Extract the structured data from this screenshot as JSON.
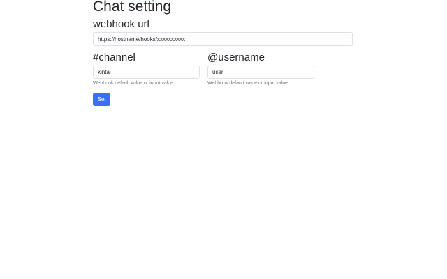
{
  "page": {
    "title": "Chat setting"
  },
  "webhook": {
    "label": "webhook url",
    "value": "https://hostname/hooks/xxxxxxxxxx"
  },
  "channel": {
    "label": "#channel",
    "value": "kintai",
    "help": "Webhook default value or input value."
  },
  "username": {
    "label": "@username",
    "value": "user",
    "help": "Webhook default value or input value."
  },
  "actions": {
    "set_label": "Set"
  }
}
